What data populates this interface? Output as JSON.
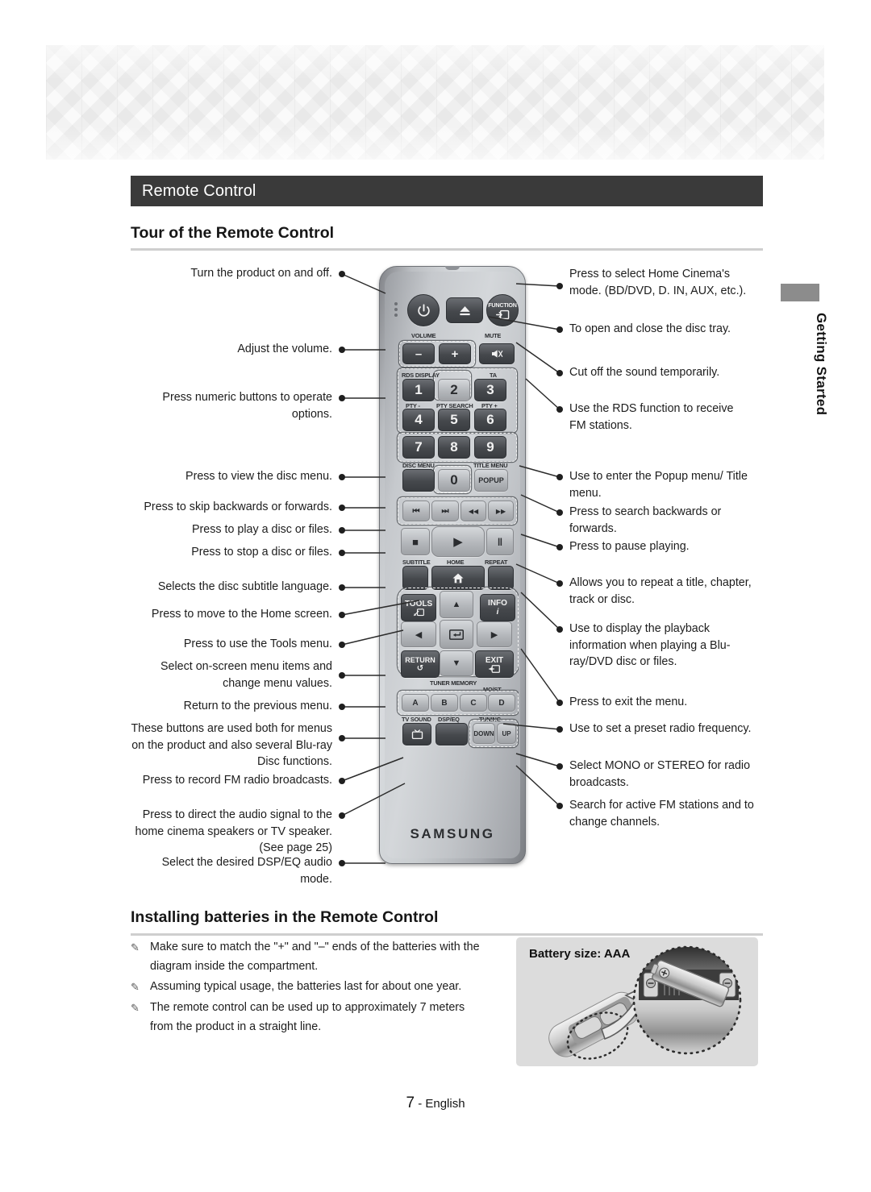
{
  "page": {
    "section_tab": "Getting Started",
    "footer_page_number": "7",
    "footer_lang": "- English"
  },
  "title_bar": {
    "text": "Remote Control"
  },
  "sections": {
    "tour": {
      "heading": "Tour of the Remote Control"
    },
    "batteries": {
      "heading": "Installing batteries in the Remote Control"
    }
  },
  "callouts_left": [
    {
      "id": "power",
      "text": "Turn the product on and off."
    },
    {
      "id": "volume",
      "text": "Adjust the volume."
    },
    {
      "id": "numeric",
      "text": "Press numeric buttons to operate options."
    },
    {
      "id": "disc-menu",
      "text": "Press to view the disc menu."
    },
    {
      "id": "skip",
      "text": "Press to skip backwards or forwards."
    },
    {
      "id": "play",
      "text": "Press to play a disc or files."
    },
    {
      "id": "stop",
      "text": "Press to stop a disc or files."
    },
    {
      "id": "subtitle",
      "text": "Selects the disc subtitle language."
    },
    {
      "id": "home",
      "text": "Press to move to the Home screen."
    },
    {
      "id": "tools",
      "text": "Press to use the Tools menu."
    },
    {
      "id": "dpad",
      "text": "Select on-screen menu items and change menu values."
    },
    {
      "id": "return",
      "text": "Return to the previous menu."
    },
    {
      "id": "abcd",
      "text": "These buttons are used both for menus on the product and also several Blu-ray Disc functions."
    },
    {
      "id": "record",
      "text": "Press to record FM radio broadcasts."
    },
    {
      "id": "tv-sound",
      "text": "Press to direct the audio signal to the home cinema speakers or TV speaker. (See page 25)"
    },
    {
      "id": "dsp-eq",
      "text": "Select the desired DSP/EQ audio mode."
    }
  ],
  "callouts_right": [
    {
      "id": "function",
      "text": "Press to select Home Cinema's mode. (BD/DVD, D. IN, AUX, etc.)."
    },
    {
      "id": "eject",
      "text": "To open and close the disc tray."
    },
    {
      "id": "mute",
      "text": "Cut off the sound temporarily."
    },
    {
      "id": "rds",
      "text": "Use the RDS function to receive FM stations."
    },
    {
      "id": "popup",
      "text": "Use to enter the Popup menu/ Title menu."
    },
    {
      "id": "search",
      "text": "Press to search backwards or forwards."
    },
    {
      "id": "pause",
      "text": "Press to pause playing."
    },
    {
      "id": "repeat",
      "text": "Allows you to repeat a title, chapter, track or disc."
    },
    {
      "id": "info",
      "text": "Use to display the playback information when playing a Blu-ray/DVD disc or files."
    },
    {
      "id": "exit",
      "text": "Press to exit the menu."
    },
    {
      "id": "tuner-memory",
      "text": "Use to set a preset radio frequency."
    },
    {
      "id": "mo-st",
      "text": "Select MONO or STEREO for radio broadcasts."
    },
    {
      "id": "tuning",
      "text": "Search for active FM stations and to change channels."
    }
  ],
  "remote": {
    "brand": "SAMSUNG",
    "keys": {
      "power": "power-icon",
      "eject": "eject-icon",
      "function": "FUNCTION",
      "volume_label": "VOLUME",
      "volume_minus": "–",
      "volume_plus": "+",
      "mute_label": "MUTE",
      "mute": "mute-icon",
      "rds_display": "RDS DISPLAY",
      "ta": "TA",
      "pty_minus": "PTY -",
      "pty_search": "PTY SEARCH",
      "pty_plus": "PTY +",
      "numbers": [
        "1",
        "2",
        "3",
        "4",
        "5",
        "6",
        "7",
        "8",
        "9"
      ],
      "zero": "0",
      "disc_menu": "DISC MENU",
      "title_menu": "TITLE MENU",
      "popup": "POPUP",
      "skip_back": "⏮",
      "skip_fwd": "⏭",
      "search_back": "◀◀",
      "search_fwd": "▶▶",
      "stop": "■",
      "play": "▶",
      "pause": "‖",
      "subtitle": "SUBTITLE",
      "home_label": "HOME",
      "home": "home-icon",
      "repeat": "REPEAT",
      "tools": "TOOLS",
      "info": "INFO",
      "info_sub": "i",
      "up": "▲",
      "down": "▼",
      "left": "◀",
      "right": "▶",
      "enter": "enter-icon",
      "return": "RETURN",
      "return_sub": "↺",
      "exit": "EXIT",
      "tuner_memory": "TUNER MEMORY",
      "mo_st": "MO/ST",
      "color_a": "A",
      "color_b": "B",
      "color_c": "C",
      "color_d": "D",
      "tv_sound_label": "TV SOUND",
      "tv_sound": "tv-icon",
      "dsp_eq_label": "DSP/EQ",
      "tuning_label": "TUNING",
      "tuning_down": "DOWN",
      "tuning_up": "UP"
    }
  },
  "battery_notes": [
    "Make sure to match the \"+\" and \"–\" ends of the batteries with the diagram inside the compartment.",
    "Assuming typical usage, the batteries last for about one year.",
    "The remote control can be used up to approximately 7 meters from the product in a straight line."
  ],
  "battery_box": {
    "title": "Battery size: AAA"
  },
  "colors": {
    "title_bar_bg": "#3a3a3a",
    "rule": "#cfcfcf",
    "tab_bar": "#8c8c8c",
    "batt_box_bg": "#dcdcdc"
  }
}
